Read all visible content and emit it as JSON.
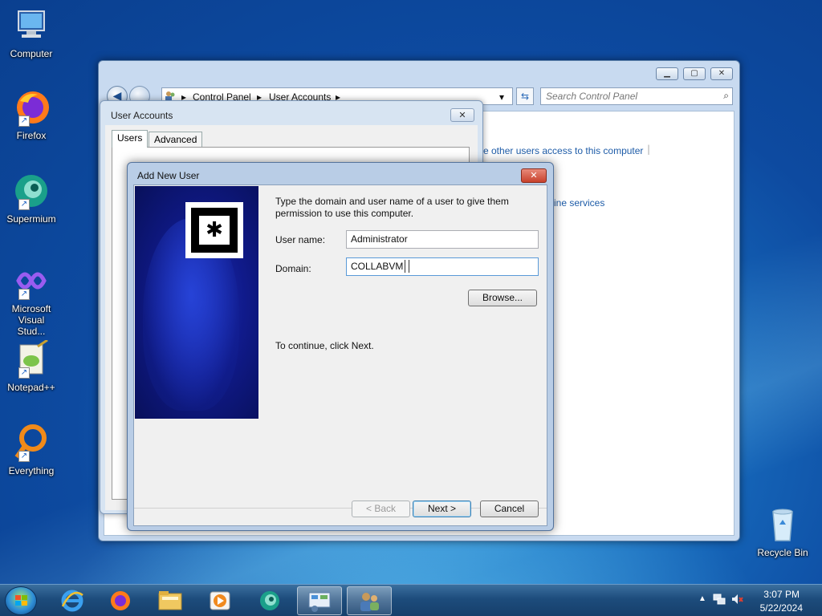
{
  "desktop": {
    "icons": [
      {
        "label": "Computer",
        "icon": "computer-icon"
      },
      {
        "label": "Firefox",
        "icon": "firefox-icon"
      },
      {
        "label": "Supermium",
        "icon": "supermium-icon"
      },
      {
        "label": "Microsoft Visual Stud...",
        "icon": "visual-studio-icon"
      },
      {
        "label": "Notepad++",
        "icon": "notepadpp-icon"
      },
      {
        "label": "Everything",
        "icon": "everything-icon"
      },
      {
        "label": "Recycle Bin",
        "icon": "recycle-bin-icon"
      }
    ]
  },
  "control_panel": {
    "breadcrumb": [
      "Control Panel",
      "User Accounts"
    ],
    "search_placeholder": "Search Control Panel",
    "links": [
      "e other users access to this computer",
      "ine services"
    ]
  },
  "user_accounts": {
    "title": "User Accounts",
    "tabs": [
      "Users",
      "Advanced"
    ]
  },
  "add_new_user": {
    "title": "Add New User",
    "instructions": "Type the domain and user name of a user to give them permission to use this computer.",
    "user_name_label": "User name:",
    "user_name_value": "Administrator",
    "domain_label": "Domain:",
    "domain_value": "COLLABVM",
    "browse_label": "Browse...",
    "continue_text": "To continue, click Next.",
    "back_label": "< Back",
    "next_label": "Next >",
    "cancel_label": "Cancel"
  },
  "taskbar": {
    "apps": [
      "internet-explorer-icon",
      "firefox-icon",
      "file-explorer-icon",
      "media-player-icon",
      "supermium-icon",
      "control-panel-icon",
      "user-accounts-icon"
    ],
    "time": "3:07 PM",
    "date": "5/22/2024"
  }
}
